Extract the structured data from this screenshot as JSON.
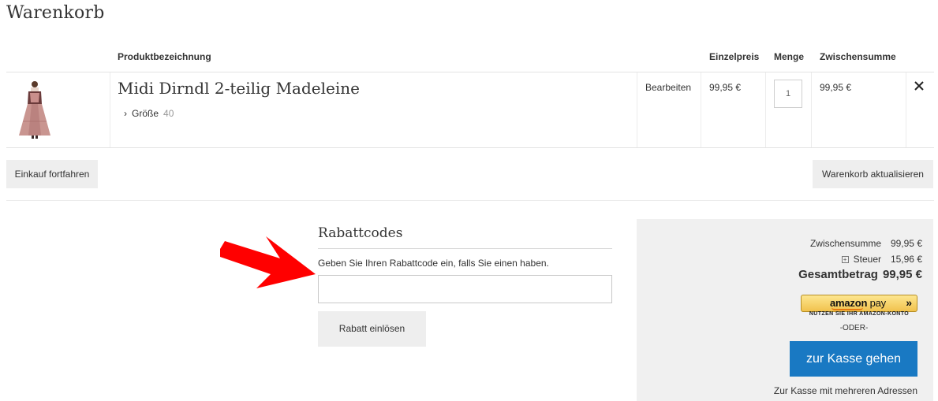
{
  "page": {
    "title": "Warenkorb"
  },
  "cart_table": {
    "headers": {
      "product": "Produktbezeichnung",
      "price": "Einzelpreis",
      "qty": "Menge",
      "subtotal": "Zwischensumme"
    },
    "items": [
      {
        "name": "Midi Dirndl 2-teilig Madeleine",
        "option_label": "Größe",
        "option_value": "40",
        "edit_label": "Bearbeiten",
        "price": "99,95 €",
        "qty": "1",
        "subtotal": "99,95 €",
        "remove_icon": "close-icon"
      }
    ]
  },
  "actions": {
    "continue_label": "Einkauf fortfahren",
    "update_label": "Warenkorb aktualisieren"
  },
  "discount": {
    "title": "Rabattcodes",
    "hint": "Geben Sie Ihren Rabattcode ein, falls Sie einen haben.",
    "input_value": "",
    "apply_label": "Rabatt einlösen"
  },
  "summary": {
    "subtotal_label": "Zwischensumme",
    "subtotal_value": "99,95 €",
    "tax_label": "Steuer",
    "tax_value": "15,96 €",
    "total_label": "Gesamtbetrag",
    "total_value": "99,95 €",
    "amazon_logo_text": "amazon",
    "amazon_pay_text": "pay",
    "amazon_sub": "NUTZEN SIE IHR AMAZON-KONTO",
    "or_label": "-ODER-",
    "checkout_label": "zur Kasse gehen",
    "multi_address_label": "Zur Kasse mit mehreren Adressen"
  },
  "colors": {
    "accent": "#1979c3",
    "arrow": "#ff0000",
    "amazon_yellow": "#f6d46a"
  }
}
